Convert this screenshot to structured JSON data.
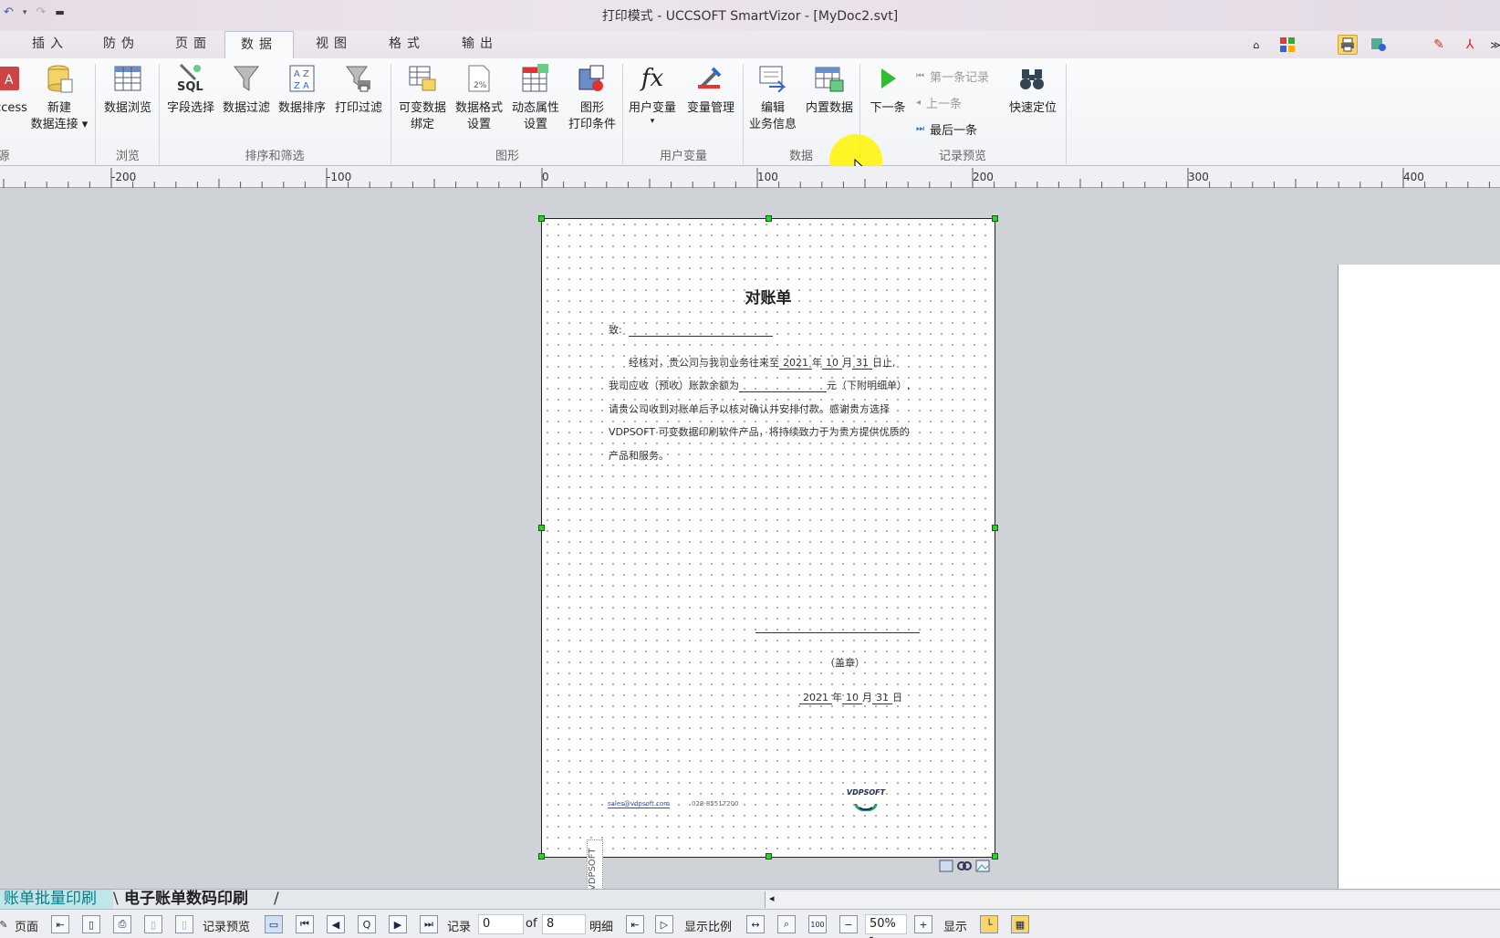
{
  "window": {
    "title": "打印模式 - UCCSOFT SmartVizor - [MyDoc2.svt]"
  },
  "tabs": [
    "插入",
    "防伪",
    "页面",
    "数据",
    "视图",
    "格式",
    "输出"
  ],
  "active_tab": "数据",
  "ribbon": {
    "access": "ccess",
    "new_conn": [
      "新建",
      "数据连接"
    ],
    "browse": "数据浏览",
    "field_select": "字段选择",
    "data_filter": "数据过滤",
    "data_sort": "数据排序",
    "print_filter": "打印过滤",
    "var_bind": [
      "可变数据",
      "绑定"
    ],
    "data_format": [
      "数据格式",
      "设置"
    ],
    "dyn_attr": [
      "动态属性",
      "设置"
    ],
    "graph_cond": [
      "图形",
      "打印条件"
    ],
    "user_var": "用户变量",
    "var_mgmt": "变量管理",
    "edit_biz": [
      "编辑",
      "业务信息"
    ],
    "builtin_data": "内置数据",
    "next": "下一条",
    "first_record": "第一条记录",
    "prev": "上一条",
    "last": "最后一条",
    "quick_locate": "快速定位",
    "groups": {
      "source": "源",
      "browse": "浏览",
      "sort_filter": "排序和筛选",
      "graphics": "图形",
      "user_var": "用户变量",
      "data": "数据",
      "record_preview": "记录预览"
    }
  },
  "ruler": {
    "labels": [
      "-200",
      "-100",
      "0",
      "100",
      "200",
      "300",
      "400"
    ]
  },
  "document": {
    "title": "对账单",
    "to": "致:",
    "p1a": "经核对，贵公司与我司业务往来至",
    "year": "2021",
    "nian": "年",
    "month": "10",
    "yue": "月",
    "day": "31",
    "p1b": "日止,",
    "p2a": "我司应收（预收）账款余额为",
    "p2b": "元（下附明细单）,",
    "p3": "请贵公司收到对账单后予以核对确认并安排付款。感谢贵方选择",
    "p4": "VDPSOFT 可变数据印刷软件产品，将持续致力于为贵方提供优质的",
    "p5": "产品和服务。",
    "seal": "（盖章）",
    "sign_year": "2021",
    "sign_month": "10",
    "sign_day": "31",
    "ri": "日",
    "email": "sales@vdpsoft.com",
    "phone": "028-85517200",
    "logo": "VDPSOFT",
    "vertical": "VDPSOFT"
  },
  "sheets": [
    "账单批量印刷",
    "电子账单数码印刷"
  ],
  "status": {
    "page": "页面",
    "record_preview": "记录预览",
    "record": "记录",
    "record_value": "0",
    "of": "of",
    "total": "8",
    "detail": "明细",
    "ratio": "显示比例",
    "zoom": "50%",
    "show": "显示"
  }
}
